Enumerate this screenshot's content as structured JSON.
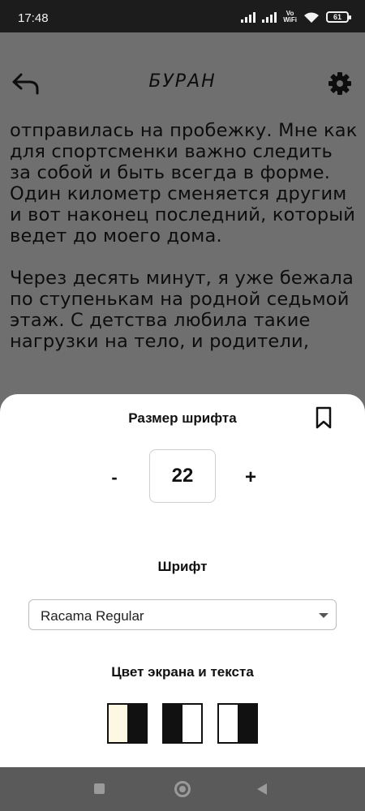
{
  "status_bar": {
    "time": "17:48",
    "network_label_top": "Vo",
    "network_label_bottom": "WiFi",
    "battery": "61"
  },
  "header": {
    "title": "БУРАН",
    "back_icon": "back-arrow-icon",
    "settings_icon": "gear-icon"
  },
  "reader": {
    "paragraphs": [
      "отправилась на пробежку. Мне как для спортсменки важно следить за собой и быть всегда в форме. Один километр сменяется другим и вот наконец последний, который ведет до моего дома.",
      "Через десять минут, я уже бежала по ступенькам на родной седьмой этаж. С детства любила такие нагрузки на тело, и родители,"
    ]
  },
  "settings_sheet": {
    "font_size_title": "Размер шрифта",
    "decrease_label": "-",
    "font_size_value": "22",
    "increase_label": "+",
    "font_title": "Шрифт",
    "font_selected": "Racama Regular",
    "color_title": "Цвет экрана и текста",
    "color_schemes": [
      {
        "left": "#fdf8e4",
        "right": "#111111"
      },
      {
        "left": "#111111",
        "right": "#ffffff"
      },
      {
        "left": "#ffffff",
        "right": "#111111"
      }
    ],
    "bookmark_icon": "bookmark-icon"
  },
  "nav_bar": {
    "recents_icon": "square-recents-icon",
    "home_icon": "circle-home-icon",
    "back_icon": "triangle-back-icon"
  },
  "colors": {
    "dimmed_background": "#6f6f6f",
    "sheet_background": "#ffffff",
    "status_bar": "#1c1c1c",
    "nav_bar": "#5a5a5a"
  }
}
